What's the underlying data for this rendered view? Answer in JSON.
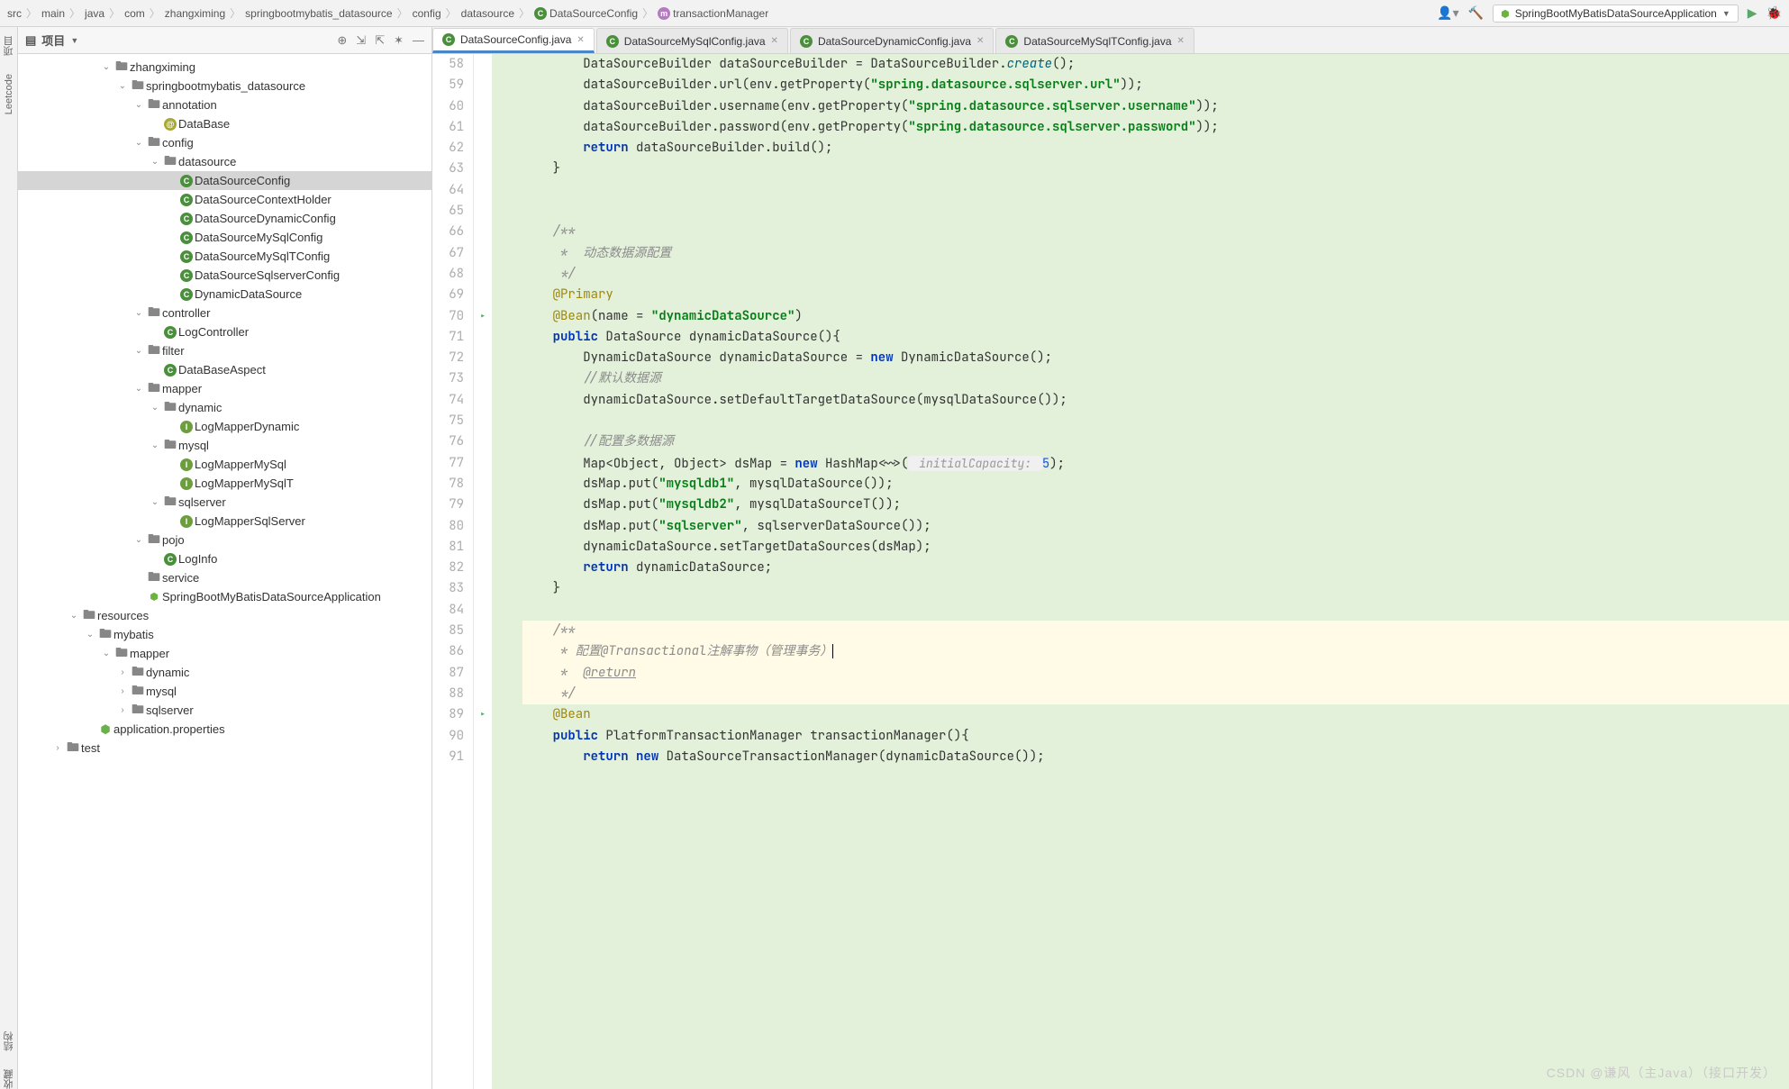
{
  "breadcrumb": [
    "src",
    "main",
    "java",
    "com",
    "zhangximing",
    "springbootmybatis_datasource",
    "config",
    "datasource",
    "DataSourceConfig",
    "transactionManager"
  ],
  "run_config": {
    "label": "SpringBootMyBatisDataSourceApplication"
  },
  "panel": {
    "title": "项目"
  },
  "tree": [
    {
      "indent": 5,
      "arrow": "open",
      "type": "folder",
      "label": "zhangximing"
    },
    {
      "indent": 6,
      "arrow": "open",
      "type": "folder",
      "label": "springbootmybatis_datasource"
    },
    {
      "indent": 7,
      "arrow": "open",
      "type": "folder",
      "label": "annotation"
    },
    {
      "indent": 8,
      "arrow": "",
      "type": "ann",
      "label": "DataBase"
    },
    {
      "indent": 7,
      "arrow": "open",
      "type": "folder",
      "label": "config"
    },
    {
      "indent": 8,
      "arrow": "open",
      "type": "folder",
      "label": "datasource"
    },
    {
      "indent": 9,
      "arrow": "",
      "type": "class",
      "label": "DataSourceConfig",
      "selected": true
    },
    {
      "indent": 9,
      "arrow": "",
      "type": "class",
      "label": "DataSourceContextHolder"
    },
    {
      "indent": 9,
      "arrow": "",
      "type": "class",
      "label": "DataSourceDynamicConfig"
    },
    {
      "indent": 9,
      "arrow": "",
      "type": "class",
      "label": "DataSourceMySqlConfig"
    },
    {
      "indent": 9,
      "arrow": "",
      "type": "class",
      "label": "DataSourceMySqlTConfig"
    },
    {
      "indent": 9,
      "arrow": "",
      "type": "class",
      "label": "DataSourceSqlserverConfig"
    },
    {
      "indent": 9,
      "arrow": "",
      "type": "class",
      "label": "DynamicDataSource"
    },
    {
      "indent": 7,
      "arrow": "open",
      "type": "folder",
      "label": "controller"
    },
    {
      "indent": 8,
      "arrow": "",
      "type": "class",
      "label": "LogController"
    },
    {
      "indent": 7,
      "arrow": "open",
      "type": "folder",
      "label": "filter"
    },
    {
      "indent": 8,
      "arrow": "",
      "type": "class",
      "label": "DataBaseAspect"
    },
    {
      "indent": 7,
      "arrow": "open",
      "type": "folder",
      "label": "mapper"
    },
    {
      "indent": 8,
      "arrow": "open",
      "type": "folder",
      "label": "dynamic"
    },
    {
      "indent": 9,
      "arrow": "",
      "type": "iface",
      "label": "LogMapperDynamic"
    },
    {
      "indent": 8,
      "arrow": "open",
      "type": "folder",
      "label": "mysql"
    },
    {
      "indent": 9,
      "arrow": "",
      "type": "iface",
      "label": "LogMapperMySql"
    },
    {
      "indent": 9,
      "arrow": "",
      "type": "iface",
      "label": "LogMapperMySqlT"
    },
    {
      "indent": 8,
      "arrow": "open",
      "type": "folder",
      "label": "sqlserver"
    },
    {
      "indent": 9,
      "arrow": "",
      "type": "iface",
      "label": "LogMapperSqlServer"
    },
    {
      "indent": 7,
      "arrow": "open",
      "type": "folder",
      "label": "pojo"
    },
    {
      "indent": 8,
      "arrow": "",
      "type": "class",
      "label": "LogInfo"
    },
    {
      "indent": 7,
      "arrow": "",
      "type": "folder",
      "label": "service"
    },
    {
      "indent": 7,
      "arrow": "",
      "type": "spring",
      "label": "SpringBootMyBatisDataSourceApplication"
    },
    {
      "indent": 3,
      "arrow": "open",
      "type": "folder",
      "label": "resources"
    },
    {
      "indent": 4,
      "arrow": "open",
      "type": "folder",
      "label": "mybatis"
    },
    {
      "indent": 5,
      "arrow": "open",
      "type": "folder",
      "label": "mapper"
    },
    {
      "indent": 6,
      "arrow": "closed",
      "type": "folder",
      "label": "dynamic"
    },
    {
      "indent": 6,
      "arrow": "closed",
      "type": "folder",
      "label": "mysql"
    },
    {
      "indent": 6,
      "arrow": "closed",
      "type": "folder",
      "label": "sqlserver"
    },
    {
      "indent": 4,
      "arrow": "",
      "type": "props",
      "label": "application.properties"
    },
    {
      "indent": 2,
      "arrow": "closed",
      "type": "folder",
      "label": "test"
    }
  ],
  "tabs": [
    {
      "label": "DataSourceConfig.java",
      "active": true
    },
    {
      "label": "DataSourceMySqlConfig.java",
      "active": false
    },
    {
      "label": "DataSourceDynamicConfig.java",
      "active": false
    },
    {
      "label": "DataSourceMySqlTConfig.java",
      "active": false
    }
  ],
  "line_start": 58,
  "code_lines": [
    {
      "n": 58,
      "html": "        DataSourceBuilder dataSourceBuilder = DataSourceBuilder.<span class='mtd' style='font-style:italic'>create</span>();"
    },
    {
      "n": 59,
      "html": "        dataSourceBuilder.url(env.getProperty(<span class='str'>\"spring.datasource.sqlserver.url\"</span>));"
    },
    {
      "n": 60,
      "html": "        dataSourceBuilder.username(env.getProperty(<span class='str'>\"spring.datasource.sqlserver.username\"</span>));"
    },
    {
      "n": 61,
      "html": "        dataSourceBuilder.password(env.getProperty(<span class='str'>\"spring.datasource.sqlserver.password\"</span>));"
    },
    {
      "n": 62,
      "html": "        <span class='kw'>return</span> dataSourceBuilder.build();"
    },
    {
      "n": 63,
      "html": "    }"
    },
    {
      "n": 64,
      "html": ""
    },
    {
      "n": 65,
      "html": ""
    },
    {
      "n": 66,
      "html": "    <span class='cmt'>/**</span>"
    },
    {
      "n": 67,
      "html": "    <span class='cmt'> *  动态数据源配置</span>"
    },
    {
      "n": 68,
      "html": "    <span class='cmt'> */</span>"
    },
    {
      "n": 69,
      "html": "    <span class='ann'>@Primary</span>"
    },
    {
      "n": 70,
      "html": "    <span class='ann'>@Bean</span>(name = <span class='str'>\"dynamicDataSource\"</span>)",
      "gut": "run"
    },
    {
      "n": 71,
      "html": "    <span class='kw'>public</span> DataSource dynamicDataSource(){"
    },
    {
      "n": 72,
      "html": "        DynamicDataSource dynamicDataSource = <span class='new'>new</span> DynamicDataSource();"
    },
    {
      "n": 73,
      "html": "        <span class='cmt'>//默认数据源</span>"
    },
    {
      "n": 74,
      "html": "        dynamicDataSource.setDefaultTargetDataSource(mysqlDataSource());"
    },
    {
      "n": 75,
      "html": ""
    },
    {
      "n": 76,
      "html": "        <span class='cmt'>//配置多数据源</span>"
    },
    {
      "n": 77,
      "html": "        Map&lt;Object, Object&gt; dsMap = <span class='new'>new</span> HashMap&lt;~&gt;(<span class='param-hint'> initialCapacity: </span><span class='num'>5</span>);"
    },
    {
      "n": 78,
      "html": "        dsMap.put(<span class='str'>\"mysqldb1\"</span>, mysqlDataSource());"
    },
    {
      "n": 79,
      "html": "        dsMap.put(<span class='str'>\"mysqldb2\"</span>, mysqlDataSourceT());"
    },
    {
      "n": 80,
      "html": "        dsMap.put(<span class='str'>\"sqlserver\"</span>, sqlserverDataSource());"
    },
    {
      "n": 81,
      "html": "        dynamicDataSource.setTargetDataSources(dsMap);"
    },
    {
      "n": 82,
      "html": "        <span class='kw'>return</span> dynamicDataSource;"
    },
    {
      "n": 83,
      "html": "    }"
    },
    {
      "n": 84,
      "html": ""
    },
    {
      "n": 85,
      "html": "    <span class='cmt'>/**</span>",
      "yellow": true
    },
    {
      "n": 86,
      "html": "    <span class='cmt'> * 配置@Transactional注解事物（管理事务）</span><span class='caret'></span>",
      "yellow": true
    },
    {
      "n": 87,
      "html": "    <span class='cmt'> *  </span><span class='doc-tag'>@return</span>",
      "yellow": true
    },
    {
      "n": 88,
      "html": "    <span class='cmt'> */</span>",
      "yellow": true
    },
    {
      "n": 89,
      "html": "    <span class='ann'>@Bean</span>",
      "gut": "run"
    },
    {
      "n": 90,
      "html": "    <span class='kw'>public</span> PlatformTransactionManager transactionManager(){"
    },
    {
      "n": 91,
      "html": "        <span class='kw'>return</span> <span class='new'>new</span> DataSourceTransactionManager(dynamicDataSource());"
    }
  ],
  "sidebar_tabs": [
    "项目",
    "Leetcode",
    "结构",
    "收藏"
  ],
  "watermark": "CSDN @谦风（主Java）（接口开发）"
}
